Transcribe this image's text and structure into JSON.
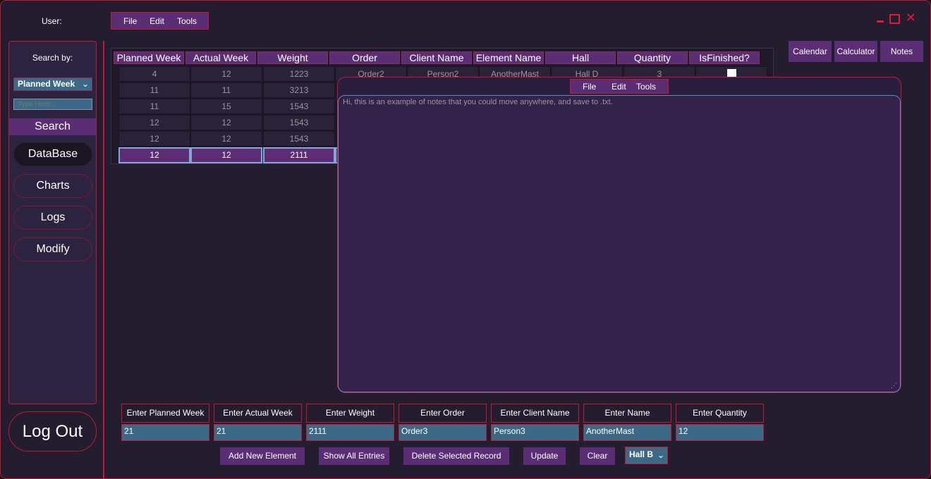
{
  "header": {
    "user_label": "User:"
  },
  "menu": {
    "file": "File",
    "edit": "Edit",
    "tools": "Tools"
  },
  "sidebar": {
    "search_by": "Search by:",
    "search_field": "Planned Week",
    "search_placeholder": "Type Here...",
    "search_button": "Search",
    "nav": [
      "DataBase",
      "Charts",
      "Logs",
      "Modify"
    ],
    "logout": "Log Out"
  },
  "table": {
    "headers": [
      "Planned Week",
      "Actual Week",
      "Weight",
      "Order",
      "Client Name",
      "Element Name",
      "Hall",
      "Quantity",
      "IsFinished?"
    ],
    "rows": [
      {
        "pw": "4",
        "aw": "12",
        "weight": "1223",
        "order": "Order2",
        "client": "Person2",
        "element": "AnotherMast",
        "hall": "Hall D",
        "qty": "3",
        "finished": false
      },
      {
        "pw": "11",
        "aw": "11",
        "weight": "3213"
      },
      {
        "pw": "11",
        "aw": "15",
        "weight": "1543"
      },
      {
        "pw": "12",
        "aw": "12",
        "weight": "1543"
      },
      {
        "pw": "12",
        "aw": "12",
        "weight": "1543"
      },
      {
        "pw": "12",
        "aw": "12",
        "weight": "2111",
        "selected": true
      }
    ]
  },
  "notes": {
    "text": "Hi, this is an example of notes that you could move anywhere, and save to .txt."
  },
  "toolbar": {
    "calendar": "Calendar",
    "calculator": "Calculator",
    "notes": "Notes"
  },
  "form": {
    "labels": [
      "Enter Planned Week",
      "Enter Actual Week",
      "Enter Weight",
      "Enter Order",
      "Enter Client Name",
      "Enter Name",
      "Enter Quantity"
    ],
    "values": [
      "21",
      "21",
      "2111",
      "Order3",
      "Person3",
      "AnotherMast",
      "12"
    ],
    "hall": "Hall B"
  },
  "actions": {
    "add": "Add New Element",
    "show_all": "Show All Entries",
    "delete": "Delete Selected Record",
    "update": "Update",
    "clear": "Clear"
  },
  "colors": {
    "accent": "#5b2d74",
    "border": "#c21838",
    "input": "#3c6a86",
    "background": "#241c2f"
  }
}
